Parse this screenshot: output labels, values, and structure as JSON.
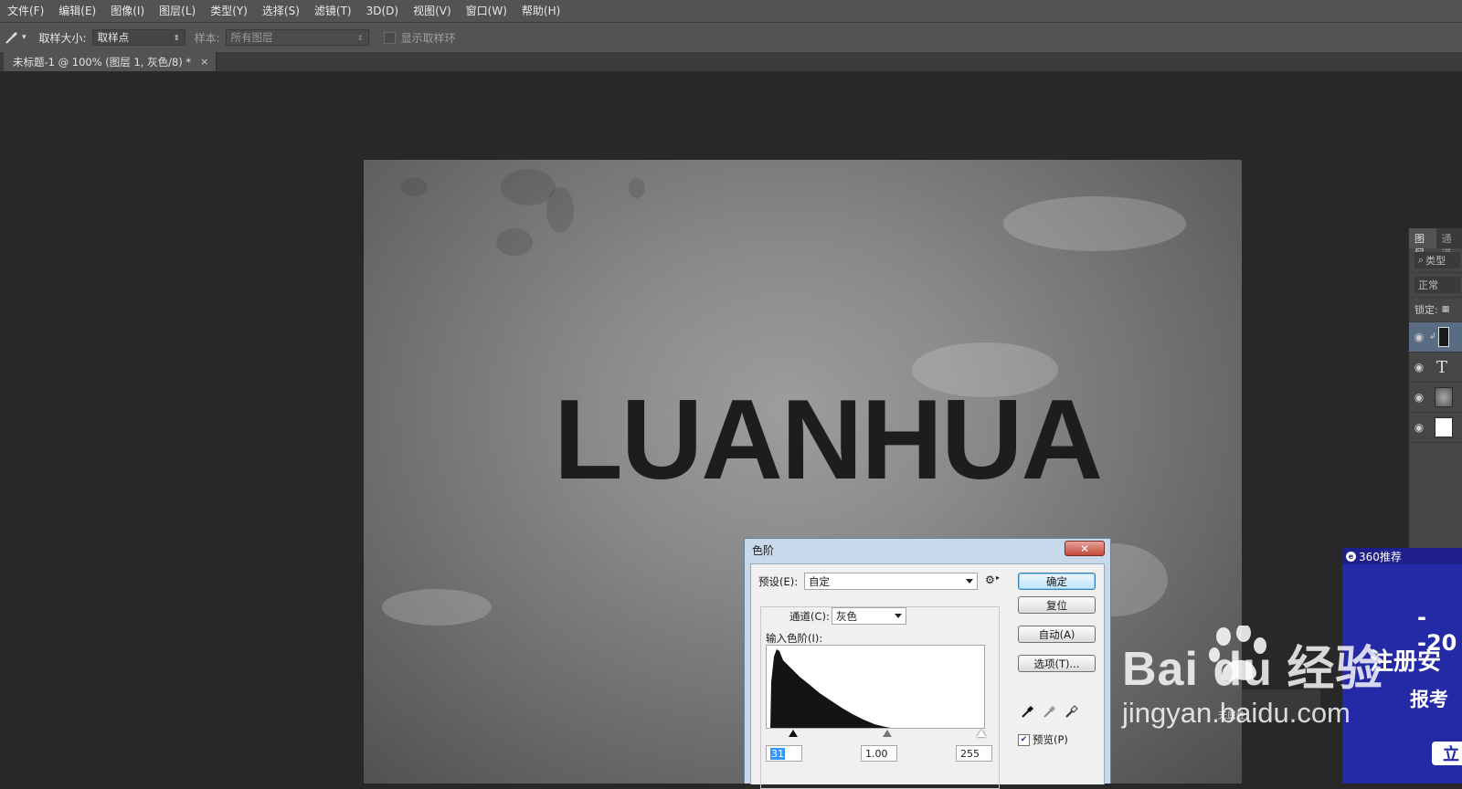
{
  "menubar": {
    "items": [
      "文件(F)",
      "编辑(E)",
      "图像(I)",
      "图层(L)",
      "类型(Y)",
      "选择(S)",
      "滤镜(T)",
      "3D(D)",
      "视图(V)",
      "窗口(W)",
      "帮助(H)"
    ]
  },
  "options": {
    "sample_size_label": "取样大小:",
    "sample_size_value": "取样点",
    "sample_label": "样本:",
    "sample_value": "所有图层",
    "show_ring_label": "显示取样环"
  },
  "document": {
    "tab_title": "未标题-1 @ 100% (图层 1, 灰色/8) *",
    "tab_close": "×",
    "canvas_text": "LUANHUA"
  },
  "layers_panel": {
    "tab_layers": "图层",
    "tab_channels": "通道",
    "filter_placeholder": "类型",
    "blend_mode": "正常",
    "lock_label": "锁定:",
    "layers": [
      {
        "thumb": "text-layer",
        "label": "T"
      },
      {
        "thumb": "texture"
      },
      {
        "thumb": "white"
      }
    ]
  },
  "levels_dialog": {
    "title": "色阶",
    "close": "✕",
    "preset_label": "预设(E):",
    "preset_value": "自定",
    "channel_label": "通道(C):",
    "channel_value": "灰色",
    "input_levels_label": "输入色阶(I):",
    "input_black": "31",
    "input_gamma": "1.00",
    "input_white": "255",
    "buttons": {
      "ok": "确定",
      "reset": "复位",
      "auto": "自动(A)",
      "options": "选项(T)..."
    },
    "preview_label": "预览(P)",
    "preview_checked": true
  },
  "ad": {
    "header": "360推荐",
    "line1": "--20",
    "line2": "注册安",
    "line3": "报考",
    "button": "立"
  },
  "watermark": {
    "brand": "Bai  du 经验",
    "url": "jingyan.baidu.com",
    "ghost_label": "无属性"
  },
  "colors": {
    "app_bg": "#282828",
    "panel_bg": "#535353",
    "dialog_frame": "#c7d9ea",
    "ad_bg": "#2429a6"
  }
}
